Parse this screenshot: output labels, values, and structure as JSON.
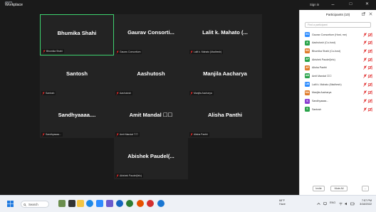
{
  "app": {
    "title_line1": "zoom",
    "title_line2": "Workplace"
  },
  "titlebar": {
    "signin": "Sign in",
    "minimize": "–",
    "maximize": "□",
    "close": "✕"
  },
  "colors": {
    "active_border": "#3ed26f",
    "mic_off": "#e02828",
    "tile_bg": "#232323",
    "stage_bg": "#1a1a1a"
  },
  "tiles": [
    {
      "name": "Bhumika Shahi",
      "label": "Bhumika Shahi"
    },
    {
      "name": "Gaurav Consorti...",
      "label": "Gaurav Consortium"
    },
    {
      "name": "Lalit k. Mahato (...",
      "label": "Lalit k. Mahato (Madhesh)"
    },
    {
      "name": "Santosh",
      "label": "Santosh"
    },
    {
      "name": "Aashutosh",
      "label": "Aashutosh"
    },
    {
      "name": "Manjila Aacharya",
      "label": "Manjila Aacharya"
    },
    {
      "name": "Sandhyaaaa....",
      "label": "Sandhyaaaa..."
    },
    {
      "name": "Amit Mandal ☐☐",
      "label": "Amit Mandal ☐☐"
    },
    {
      "name": "Alisha Panthi",
      "label": "Alisha Panthi"
    },
    {
      "name": "Abishek Paudel(...",
      "label": "Abishek Paudel(lelc)"
    }
  ],
  "participants_panel": {
    "title": "Participants (10)",
    "search_placeholder": "Find a participant",
    "participants": [
      {
        "initials": "GC",
        "name": "Gaurav Consortium (Host, me)",
        "color": "#2d8cff"
      },
      {
        "initials": "A",
        "name": "Aashutosh (Co-host)",
        "color": "#2aa34a"
      },
      {
        "initials": "BS",
        "name": "Bhumika Shahi (Co-host)",
        "color": "#e07b2a"
      },
      {
        "initials": "AP",
        "name": "Abishek Paudel(lelc)",
        "color": "#2aa34a"
      },
      {
        "initials": "AP",
        "name": "Alisha Panthi",
        "color": "#e07b2a"
      },
      {
        "initials": "AM",
        "name": "Amit Mandal ☐☐",
        "color": "#2aa34a"
      },
      {
        "initials": "LM",
        "name": "Lalit k. Mahato (Madhesh)",
        "color": "#2d8cff"
      },
      {
        "initials": "MA",
        "name": "Manjila Aacharya",
        "color": "#e07b2a"
      },
      {
        "initials": "S",
        "name": "Sandhyaaaa...",
        "color": "#8b3fd1"
      },
      {
        "initials": "S",
        "name": "Santosh",
        "color": "#2aa34a"
      }
    ],
    "invite_label": "Invite",
    "mute_all_label": "Mute All",
    "more_label": "..."
  },
  "taskbar": {
    "search_label": "Search",
    "weather_temp": "68°F",
    "weather_desc": "Haze",
    "lang": "ENG",
    "time": "7:57 PM",
    "date": "3/18/2022"
  }
}
